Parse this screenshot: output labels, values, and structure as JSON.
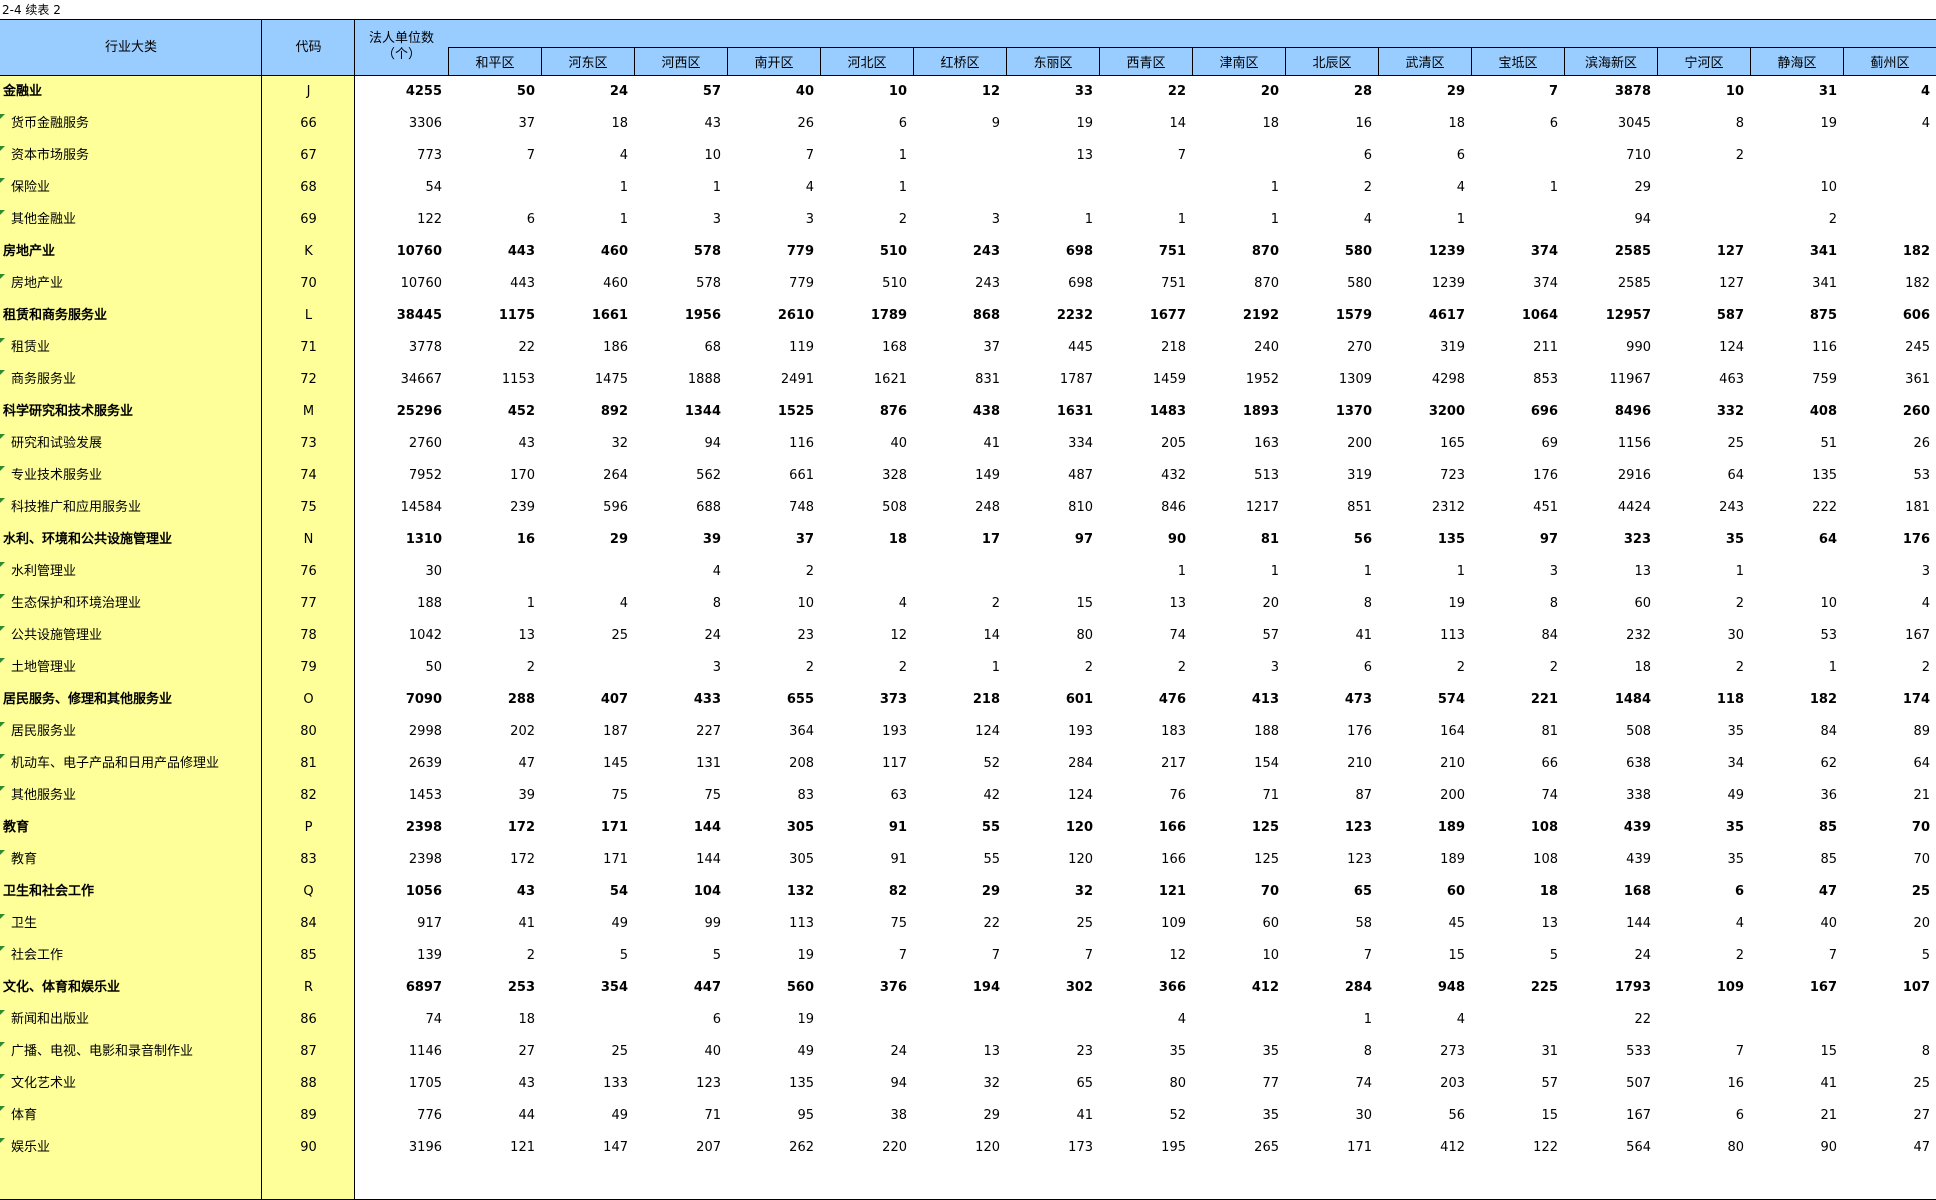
{
  "title": "2-4  续表 2",
  "headers": {
    "industry": "行业大类",
    "code": "代码",
    "total": "法人单位数\n（个）",
    "districts": [
      "和平区",
      "河东区",
      "河西区",
      "南开区",
      "河北区",
      "红桥区",
      "东丽区",
      "西青区",
      "津南区",
      "北辰区",
      "武清区",
      "宝坻区",
      "滨海新区",
      "宁河区",
      "静海区",
      "蓟州区"
    ]
  },
  "rows": [
    {
      "name": "金融业",
      "code": "J",
      "bold": true,
      "values": [
        "4255",
        "50",
        "24",
        "57",
        "40",
        "10",
        "12",
        "33",
        "22",
        "20",
        "28",
        "29",
        "7",
        "3878",
        "10",
        "31",
        "4"
      ]
    },
    {
      "name": "货币金融服务",
      "code": "66",
      "bold": false,
      "values": [
        "3306",
        "37",
        "18",
        "43",
        "26",
        "6",
        "9",
        "19",
        "14",
        "18",
        "16",
        "18",
        "6",
        "3045",
        "8",
        "19",
        "4"
      ]
    },
    {
      "name": "资本市场服务",
      "code": "67",
      "bold": false,
      "values": [
        "773",
        "7",
        "4",
        "10",
        "7",
        "1",
        "",
        "13",
        "7",
        "",
        "6",
        "6",
        "",
        "710",
        "2",
        "",
        ""
      ]
    },
    {
      "name": "保险业",
      "code": "68",
      "bold": false,
      "values": [
        "54",
        "",
        "1",
        "1",
        "4",
        "1",
        "",
        "",
        "",
        "1",
        "2",
        "4",
        "1",
        "29",
        "",
        "10",
        ""
      ]
    },
    {
      "name": "其他金融业",
      "code": "69",
      "bold": false,
      "values": [
        "122",
        "6",
        "1",
        "3",
        "3",
        "2",
        "3",
        "1",
        "1",
        "1",
        "4",
        "1",
        "",
        "94",
        "",
        "2",
        ""
      ]
    },
    {
      "name": "房地产业",
      "code": "K",
      "bold": true,
      "values": [
        "10760",
        "443",
        "460",
        "578",
        "779",
        "510",
        "243",
        "698",
        "751",
        "870",
        "580",
        "1239",
        "374",
        "2585",
        "127",
        "341",
        "182"
      ]
    },
    {
      "name": "房地产业",
      "code": "70",
      "bold": false,
      "values": [
        "10760",
        "443",
        "460",
        "578",
        "779",
        "510",
        "243",
        "698",
        "751",
        "870",
        "580",
        "1239",
        "374",
        "2585",
        "127",
        "341",
        "182"
      ]
    },
    {
      "name": "租赁和商务服务业",
      "code": "L",
      "bold": true,
      "values": [
        "38445",
        "1175",
        "1661",
        "1956",
        "2610",
        "1789",
        "868",
        "2232",
        "1677",
        "2192",
        "1579",
        "4617",
        "1064",
        "12957",
        "587",
        "875",
        "606"
      ]
    },
    {
      "name": "租赁业",
      "code": "71",
      "bold": false,
      "values": [
        "3778",
        "22",
        "186",
        "68",
        "119",
        "168",
        "37",
        "445",
        "218",
        "240",
        "270",
        "319",
        "211",
        "990",
        "124",
        "116",
        "245"
      ]
    },
    {
      "name": "商务服务业",
      "code": "72",
      "bold": false,
      "values": [
        "34667",
        "1153",
        "1475",
        "1888",
        "2491",
        "1621",
        "831",
        "1787",
        "1459",
        "1952",
        "1309",
        "4298",
        "853",
        "11967",
        "463",
        "759",
        "361"
      ]
    },
    {
      "name": "科学研究和技术服务业",
      "code": "M",
      "bold": true,
      "values": [
        "25296",
        "452",
        "892",
        "1344",
        "1525",
        "876",
        "438",
        "1631",
        "1483",
        "1893",
        "1370",
        "3200",
        "696",
        "8496",
        "332",
        "408",
        "260"
      ]
    },
    {
      "name": "研究和试验发展",
      "code": "73",
      "bold": false,
      "values": [
        "2760",
        "43",
        "32",
        "94",
        "116",
        "40",
        "41",
        "334",
        "205",
        "163",
        "200",
        "165",
        "69",
        "1156",
        "25",
        "51",
        "26"
      ]
    },
    {
      "name": "专业技术服务业",
      "code": "74",
      "bold": false,
      "values": [
        "7952",
        "170",
        "264",
        "562",
        "661",
        "328",
        "149",
        "487",
        "432",
        "513",
        "319",
        "723",
        "176",
        "2916",
        "64",
        "135",
        "53"
      ]
    },
    {
      "name": "科技推广和应用服务业",
      "code": "75",
      "bold": false,
      "values": [
        "14584",
        "239",
        "596",
        "688",
        "748",
        "508",
        "248",
        "810",
        "846",
        "1217",
        "851",
        "2312",
        "451",
        "4424",
        "243",
        "222",
        "181"
      ]
    },
    {
      "name": "水利、环境和公共设施管理业",
      "code": "N",
      "bold": true,
      "values": [
        "1310",
        "16",
        "29",
        "39",
        "37",
        "18",
        "17",
        "97",
        "90",
        "81",
        "56",
        "135",
        "97",
        "323",
        "35",
        "64",
        "176"
      ]
    },
    {
      "name": "水利管理业",
      "code": "76",
      "bold": false,
      "values": [
        "30",
        "",
        "",
        "4",
        "2",
        "",
        "",
        "",
        "1",
        "1",
        "1",
        "1",
        "3",
        "13",
        "1",
        "",
        "3"
      ]
    },
    {
      "name": "生态保护和环境治理业",
      "code": "77",
      "bold": false,
      "values": [
        "188",
        "1",
        "4",
        "8",
        "10",
        "4",
        "2",
        "15",
        "13",
        "20",
        "8",
        "19",
        "8",
        "60",
        "2",
        "10",
        "4"
      ]
    },
    {
      "name": "公共设施管理业",
      "code": "78",
      "bold": false,
      "values": [
        "1042",
        "13",
        "25",
        "24",
        "23",
        "12",
        "14",
        "80",
        "74",
        "57",
        "41",
        "113",
        "84",
        "232",
        "30",
        "53",
        "167"
      ]
    },
    {
      "name": "土地管理业",
      "code": "79",
      "bold": false,
      "values": [
        "50",
        "2",
        "",
        "3",
        "2",
        "2",
        "1",
        "2",
        "2",
        "3",
        "6",
        "2",
        "2",
        "18",
        "2",
        "1",
        "2"
      ]
    },
    {
      "name": "居民服务、修理和其他服务业",
      "code": "O",
      "bold": true,
      "values": [
        "7090",
        "288",
        "407",
        "433",
        "655",
        "373",
        "218",
        "601",
        "476",
        "413",
        "473",
        "574",
        "221",
        "1484",
        "118",
        "182",
        "174"
      ]
    },
    {
      "name": "居民服务业",
      "code": "80",
      "bold": false,
      "values": [
        "2998",
        "202",
        "187",
        "227",
        "364",
        "193",
        "124",
        "193",
        "183",
        "188",
        "176",
        "164",
        "81",
        "508",
        "35",
        "84",
        "89"
      ]
    },
    {
      "name": "机动车、电子产品和日用产品修理业",
      "code": "81",
      "bold": false,
      "values": [
        "2639",
        "47",
        "145",
        "131",
        "208",
        "117",
        "52",
        "284",
        "217",
        "154",
        "210",
        "210",
        "66",
        "638",
        "34",
        "62",
        "64"
      ]
    },
    {
      "name": "其他服务业",
      "code": "82",
      "bold": false,
      "values": [
        "1453",
        "39",
        "75",
        "75",
        "83",
        "63",
        "42",
        "124",
        "76",
        "71",
        "87",
        "200",
        "74",
        "338",
        "49",
        "36",
        "21"
      ]
    },
    {
      "name": "教育",
      "code": "P",
      "bold": true,
      "values": [
        "2398",
        "172",
        "171",
        "144",
        "305",
        "91",
        "55",
        "120",
        "166",
        "125",
        "123",
        "189",
        "108",
        "439",
        "35",
        "85",
        "70"
      ]
    },
    {
      "name": "教育",
      "code": "83",
      "bold": false,
      "values": [
        "2398",
        "172",
        "171",
        "144",
        "305",
        "91",
        "55",
        "120",
        "166",
        "125",
        "123",
        "189",
        "108",
        "439",
        "35",
        "85",
        "70"
      ]
    },
    {
      "name": "卫生和社会工作",
      "code": "Q",
      "bold": true,
      "values": [
        "1056",
        "43",
        "54",
        "104",
        "132",
        "82",
        "29",
        "32",
        "121",
        "70",
        "65",
        "60",
        "18",
        "168",
        "6",
        "47",
        "25"
      ]
    },
    {
      "name": "卫生",
      "code": "84",
      "bold": false,
      "values": [
        "917",
        "41",
        "49",
        "99",
        "113",
        "75",
        "22",
        "25",
        "109",
        "60",
        "58",
        "45",
        "13",
        "144",
        "4",
        "40",
        "20"
      ]
    },
    {
      "name": "社会工作",
      "code": "85",
      "bold": false,
      "values": [
        "139",
        "2",
        "5",
        "5",
        "19",
        "7",
        "7",
        "7",
        "12",
        "10",
        "7",
        "15",
        "5",
        "24",
        "2",
        "7",
        "5"
      ]
    },
    {
      "name": "文化、体育和娱乐业",
      "code": "R",
      "bold": true,
      "values": [
        "6897",
        "253",
        "354",
        "447",
        "560",
        "376",
        "194",
        "302",
        "366",
        "412",
        "284",
        "948",
        "225",
        "1793",
        "109",
        "167",
        "107"
      ]
    },
    {
      "name": "新闻和出版业",
      "code": "86",
      "bold": false,
      "values": [
        "74",
        "18",
        "",
        "6",
        "19",
        "",
        "",
        "",
        "4",
        "",
        "1",
        "4",
        "",
        "22",
        "",
        "",
        ""
      ]
    },
    {
      "name": "广播、电视、电影和录音制作业",
      "code": "87",
      "bold": false,
      "values": [
        "1146",
        "27",
        "25",
        "40",
        "49",
        "24",
        "13",
        "23",
        "35",
        "35",
        "8",
        "273",
        "31",
        "533",
        "7",
        "15",
        "8"
      ]
    },
    {
      "name": "文化艺术业",
      "code": "88",
      "bold": false,
      "values": [
        "1705",
        "43",
        "133",
        "123",
        "135",
        "94",
        "32",
        "65",
        "80",
        "77",
        "74",
        "203",
        "57",
        "507",
        "16",
        "41",
        "25"
      ]
    },
    {
      "name": "体育",
      "code": "89",
      "bold": false,
      "values": [
        "776",
        "44",
        "49",
        "71",
        "95",
        "38",
        "29",
        "41",
        "52",
        "35",
        "30",
        "56",
        "15",
        "167",
        "6",
        "21",
        "27"
      ]
    },
    {
      "name": "娱乐业",
      "code": "90",
      "bold": false,
      "values": [
        "3196",
        "121",
        "147",
        "207",
        "262",
        "220",
        "120",
        "173",
        "195",
        "265",
        "171",
        "412",
        "122",
        "564",
        "80",
        "90",
        "47"
      ]
    }
  ]
}
